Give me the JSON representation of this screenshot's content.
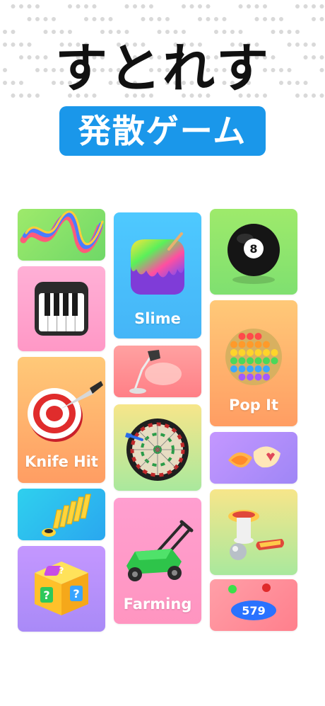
{
  "header": {
    "title": "すとれす",
    "subtitle": "発散ゲーム"
  },
  "colors": {
    "subtitle_bg": "#1a97ea",
    "title": "#111111"
  },
  "tiles": {
    "ribbon": {
      "icon": "ribbon-icon",
      "label": ""
    },
    "piano": {
      "icon": "piano-icon",
      "label": ""
    },
    "knife": {
      "icon": "target-knife-icon",
      "label": "Knife Hit"
    },
    "domino": {
      "icon": "domino-icon",
      "label": ""
    },
    "mystery": {
      "icon": "mystery-box-icon",
      "label": ""
    },
    "slime": {
      "icon": "slime-icon",
      "label": "Slime"
    },
    "lamp": {
      "icon": "desk-lamp-icon",
      "label": ""
    },
    "darts": {
      "icon": "dartboard-icon",
      "label": ""
    },
    "farming": {
      "icon": "lawn-mower-icon",
      "label": "Farming"
    },
    "ball": {
      "icon": "eight-ball-icon",
      "label": ""
    },
    "popit": {
      "icon": "pop-it-icon",
      "label": "Pop It"
    },
    "nuts": {
      "icon": "nut-shell-icon",
      "label": ""
    },
    "pinball": {
      "icon": "pinball-icon",
      "label": ""
    },
    "counter": {
      "icon": "counter-icon",
      "label": "",
      "value": "579"
    }
  }
}
